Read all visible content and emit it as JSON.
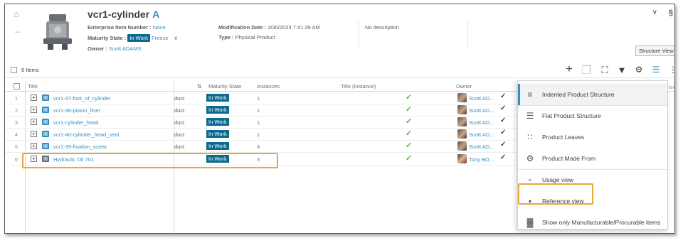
{
  "header": {
    "title": "vcr1-cylinder",
    "revision": "A",
    "enterprise_label": "Enterprise Item Number :",
    "enterprise_value": "None",
    "maturity_label": "Maturity State :",
    "maturity_value": "In Work",
    "freeze": "Freeze",
    "owner_label": "Owner :",
    "owner_value": "Scott ADAMS",
    "mod_label": "Modification Date :",
    "mod_value": "3/30/2023 7:41:39 AM",
    "type_label": "Type :",
    "type_value": "Physical Product",
    "description": "No description",
    "tooltip": "Structure View"
  },
  "toolbar": {
    "item_count": "6 Items"
  },
  "table": {
    "columns": {
      "title": "Title",
      "maturity": "Maturity State",
      "instances": "Instances",
      "title_instance": "Title (Instance)",
      "owner": "Owner"
    },
    "rows": [
      {
        "num": "1",
        "title": "vcr1-37-foot_of_cylinder",
        "type": "duct",
        "state": "In Work",
        "instances": "1",
        "owner": "Scott AD..."
      },
      {
        "num": "2",
        "title": "vcr1-36-piston_liner",
        "type": "duct",
        "state": "In Work",
        "instances": "1",
        "owner": "Scott AD..."
      },
      {
        "num": "3",
        "title": "vcr1-cylinder_head",
        "type": "duct",
        "state": "In Work",
        "instances": "1",
        "owner": "Scott AD..."
      },
      {
        "num": "4",
        "title": "vcr1-40-cylinder_head_seal",
        "type": "duct",
        "state": "In Work",
        "instances": "1",
        "owner": "Scott AD..."
      },
      {
        "num": "5",
        "title": "vcr1-39-fixation_screw",
        "type": "duct",
        "state": "In Work",
        "instances": "4",
        "owner": "Scott AD..."
      },
      {
        "num": "6",
        "title": "Hydraulic Oil 701",
        "type": "",
        "state": "In Work",
        "instances": "3",
        "owner": "Tony BO..."
      }
    ]
  },
  "menu": {
    "items": [
      {
        "label": "Indented Product Structure",
        "icon": "indented-structure-icon"
      },
      {
        "label": "Flat Product Structure",
        "icon": "flat-structure-icon"
      },
      {
        "label": "Product Leaves",
        "icon": "product-leaves-icon"
      },
      {
        "label": "Product Made From",
        "icon": "made-from-icon"
      },
      {
        "label": "Usage view",
        "icon": "usage-view-icon"
      },
      {
        "label": "Reference view",
        "icon": "reference-view-icon"
      },
      {
        "label": "Show only Manufacturable/Procurable items",
        "icon": "manufacturable-icon"
      }
    ]
  },
  "colors": {
    "accent": "#368ec4",
    "badge": "#0b6a8d",
    "highlight": "#e7a83a",
    "check": "#57b947"
  }
}
